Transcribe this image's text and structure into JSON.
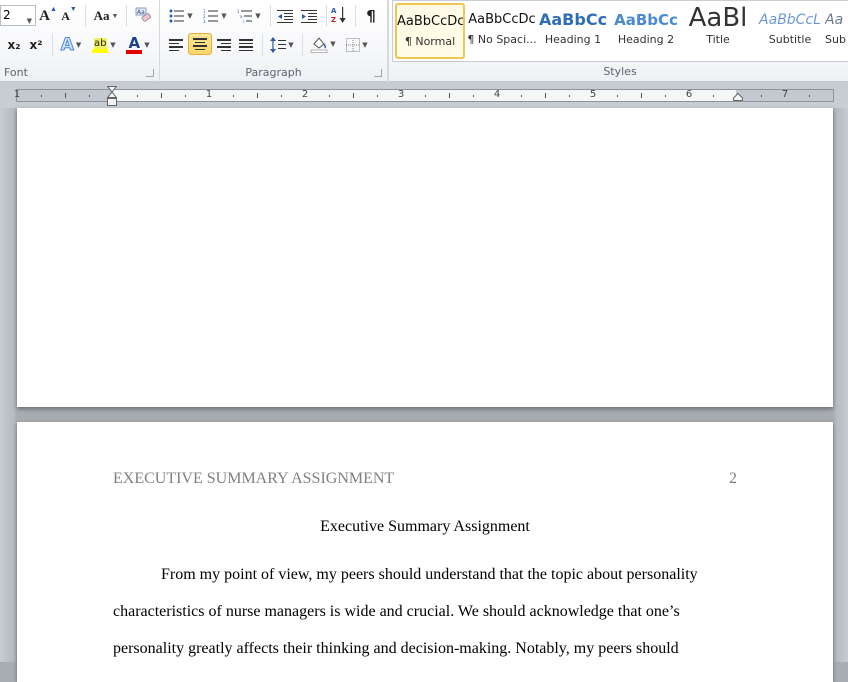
{
  "ribbon": {
    "font_group": {
      "label": "Font",
      "font_size": "2",
      "grow_font": "A",
      "shrink_font": "A",
      "change_case": "Aa",
      "subscript": "x₂",
      "superscript": "x²",
      "text_effects": "A",
      "highlight": "ab",
      "font_color": "A",
      "highlight_color": "#ffff00",
      "font_color_value": "#e00000"
    },
    "paragraph_group": {
      "label": "Paragraph",
      "show_marks": "¶",
      "sort": "A↓Z",
      "active_alignment": "center"
    },
    "styles_group": {
      "label": "Styles",
      "items": [
        {
          "sample": "AaBbCcDc",
          "name": "¶ Normal",
          "selected": true
        },
        {
          "sample": "AaBbCcDc",
          "name": "¶ No Spaci...",
          "selected": false
        },
        {
          "sample": "AaBbCc",
          "name": "Heading 1",
          "selected": false
        },
        {
          "sample": "AaBbCc",
          "name": "Heading 2",
          "selected": false
        },
        {
          "sample": "AaBl",
          "name": "Title",
          "selected": false
        },
        {
          "sample": "AaBbCcL",
          "name": "Subtitle",
          "selected": false
        },
        {
          "sample": "Aa",
          "name": "Sub",
          "selected": false
        }
      ]
    }
  },
  "ruler": {
    "numbers": [
      "1",
      "1",
      "2",
      "3",
      "4",
      "5",
      "6",
      "7"
    ]
  },
  "document": {
    "page2": {
      "header_text": "EXECUTIVE SUMMARY ASSIGNMENT",
      "page_number": "2",
      "title": "Executive Summary Assignment",
      "body_lines": [
        "From my point of view, my peers should understand that the topic about personality",
        "characteristics  of nurse managers is wide and crucial. We should acknowledge that one’s",
        "personality greatly affects their thinking and decision-making.  Notably, my peers should"
      ]
    }
  }
}
